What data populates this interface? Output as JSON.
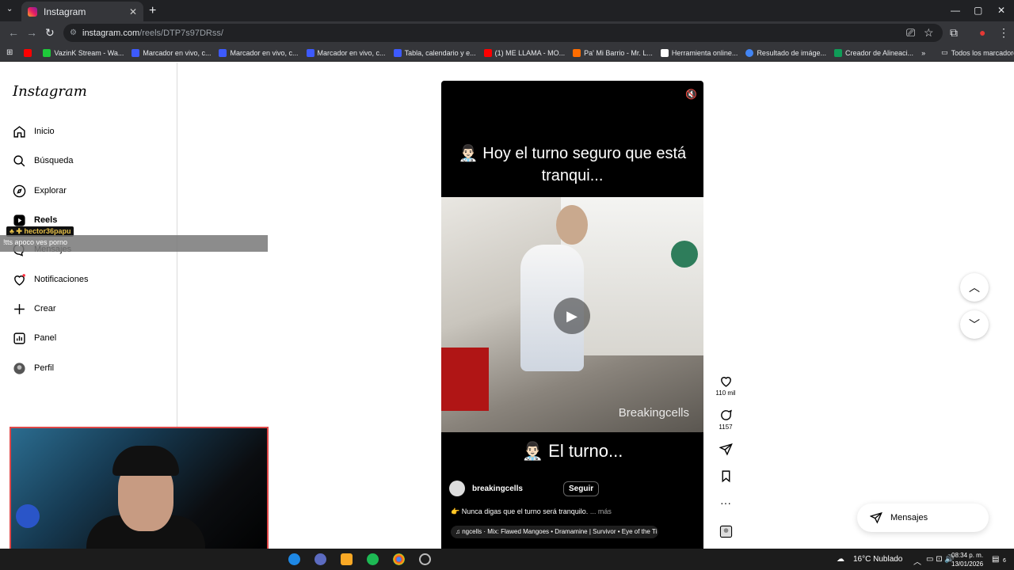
{
  "browser": {
    "tab_title": "Instagram",
    "url_host": "instagram.com",
    "url_path": "/reels/DTP7s97DRss/",
    "window_controls": [
      "—",
      "▢",
      "✕"
    ]
  },
  "bookmarks": [
    {
      "label": "VazinK Stream - Wa...",
      "color": "#1ec93a"
    },
    {
      "label": "Marcador en vivo, c...",
      "color": "#3d5afe"
    },
    {
      "label": "Marcador en vivo, c...",
      "color": "#3d5afe"
    },
    {
      "label": "Marcador en vivo, c...",
      "color": "#3d5afe"
    },
    {
      "label": "Tabla, calendario y e...",
      "color": "#3d5afe"
    },
    {
      "label": "(1) ME LLAMA - MO...",
      "color": "#ff0000"
    },
    {
      "label": "Pa' Mi Barrio - Mr. L...",
      "color": "#ff6d00"
    },
    {
      "label": "Herramienta online...",
      "color": "#ffffff"
    },
    {
      "label": "Resultado de imáge...",
      "color": "#4285f4"
    },
    {
      "label": "Creador de Alineaci...",
      "color": "#0f9d58"
    }
  ],
  "bookmarks_all": "Todos los marcadores",
  "sidebar": {
    "logo": "Instagram",
    "items": [
      {
        "label": "Inicio",
        "icon": "home-icon"
      },
      {
        "label": "Búsqueda",
        "icon": "search-icon"
      },
      {
        "label": "Explorar",
        "icon": "compass-icon"
      },
      {
        "label": "Reels",
        "icon": "reels-icon"
      },
      {
        "label": "Mensajes",
        "icon": "messenger-icon"
      },
      {
        "label": "Notificaciones",
        "icon": "heart-icon"
      },
      {
        "label": "Crear",
        "icon": "plus-icon"
      },
      {
        "label": "Panel",
        "icon": "chart-icon"
      },
      {
        "label": "Perfil",
        "icon": "avatar-icon"
      }
    ]
  },
  "stream_overlay": {
    "username": "hector36papu",
    "message": "!tts apoco ves porno"
  },
  "reel": {
    "caption_top": "👨🏻‍⚕️ Hoy el turno seguro que está tranqui...",
    "caption_bottom": "👨🏻‍⚕️ El turno...",
    "watermark": "Breakingcells",
    "author": "breakingcells",
    "follow_label": "Seguir",
    "description": "👉 Nunca digas que el turno será tranquilo.",
    "more_label": "... más",
    "audio": "♫ ngcells · Mix: Flawed Mangoes • Dramamine | Survivor • Eye of the Ti"
  },
  "actions": {
    "likes": "110 mil",
    "comments": "1157"
  },
  "messages_button": "Mensajes",
  "taskbar": {
    "weather": "16°C  Nublado",
    "time": "08:34 p. m.",
    "date": "13/01/2026",
    "notification_count": "6"
  }
}
